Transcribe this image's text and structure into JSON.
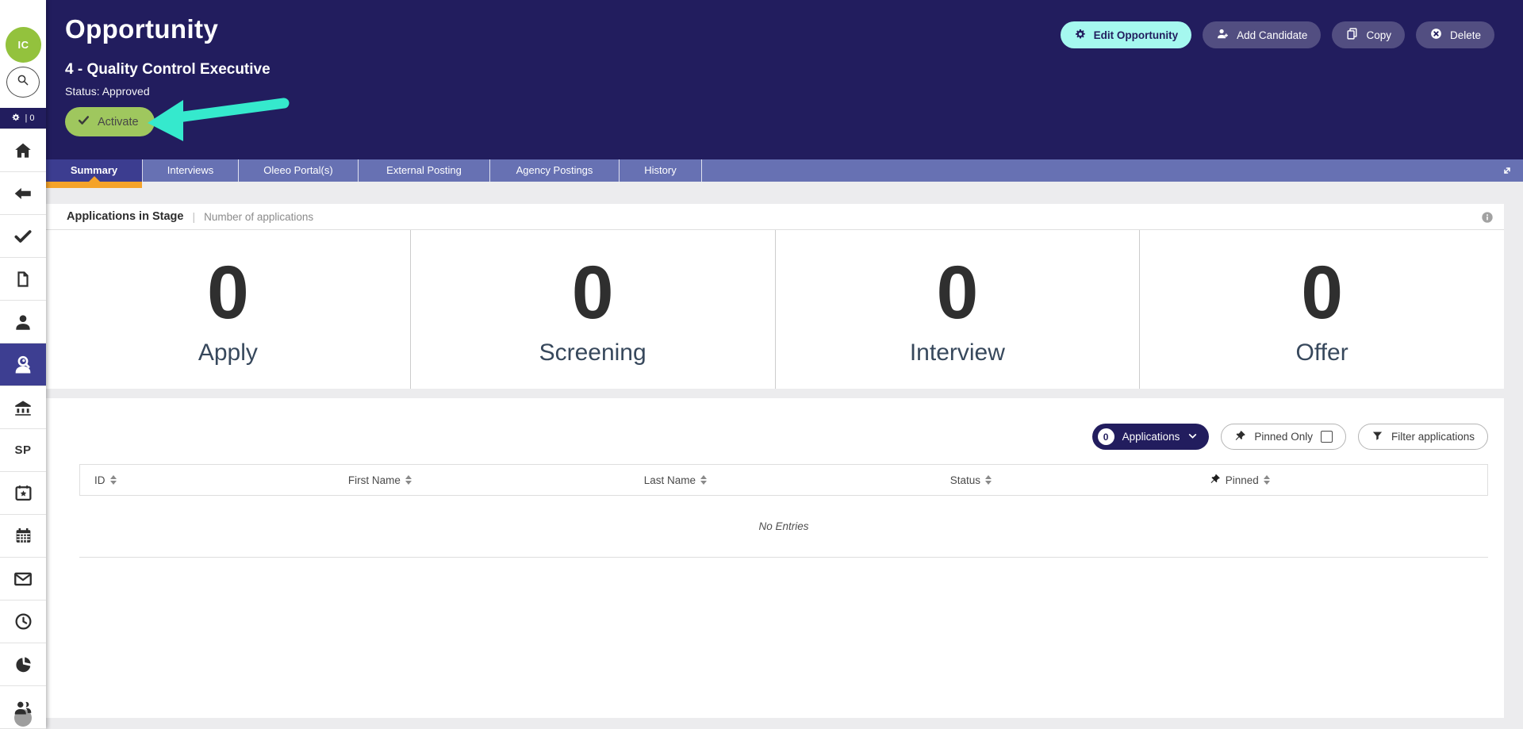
{
  "header": {
    "title": "Opportunity",
    "subtitle": "4 - Quality Control Executive",
    "status": "Status: Approved",
    "activate_button": "Activate",
    "actions": {
      "edit": "Edit Opportunity",
      "add_candidate": "Add Candidate",
      "copy": "Copy",
      "delete": "Delete"
    }
  },
  "sidebar": {
    "avatar_initials": "IC",
    "gear_count": "| 0",
    "sp_label": "SP",
    "icons": [
      "home-icon",
      "back-arrow-icon",
      "check-icon",
      "document-icon",
      "person-icon",
      "candidate-search-icon",
      "bank-icon",
      "sp-label",
      "calendar-star-icon",
      "calendar-icon",
      "envelope-icon",
      "clock-icon",
      "pie-chart-icon",
      "people-icon"
    ],
    "active_icon": "candidate-search-icon"
  },
  "tabs": {
    "items": [
      {
        "label": "Summary",
        "active": true
      },
      {
        "label": "Interviews",
        "active": false
      },
      {
        "label": "Oleeo Portal(s)",
        "active": false
      },
      {
        "label": "External Posting",
        "active": false
      },
      {
        "label": "Agency Postings",
        "active": false
      },
      {
        "label": "History",
        "active": false
      }
    ]
  },
  "stage_panel": {
    "title": "Applications in Stage",
    "separator": "|",
    "subtitle": "Number of applications"
  },
  "stats": {
    "items": [
      {
        "value": "0",
        "label": "Apply"
      },
      {
        "value": "0",
        "label": "Screening"
      },
      {
        "value": "0",
        "label": "Interview"
      },
      {
        "value": "0",
        "label": "Offer"
      }
    ]
  },
  "applications": {
    "count_badge": "0",
    "dropdown_label": "Applications",
    "pinned_only_label": "Pinned Only",
    "filter_label": "Filter applications",
    "table": {
      "columns": [
        "ID",
        "First Name",
        "Last Name",
        "Status",
        "Pinned"
      ],
      "empty_text": "No Entries"
    }
  },
  "colors": {
    "navy": "#221d5e",
    "tabbar": "#6771b3",
    "active_tab": "#3c3d90",
    "orange_underline": "#f5a329",
    "avatar_green": "#93c23d",
    "activate_green": "#9fc75e",
    "annotation_cyan": "#35e9cd",
    "edit_button_cyan": "#a5f8ef"
  }
}
